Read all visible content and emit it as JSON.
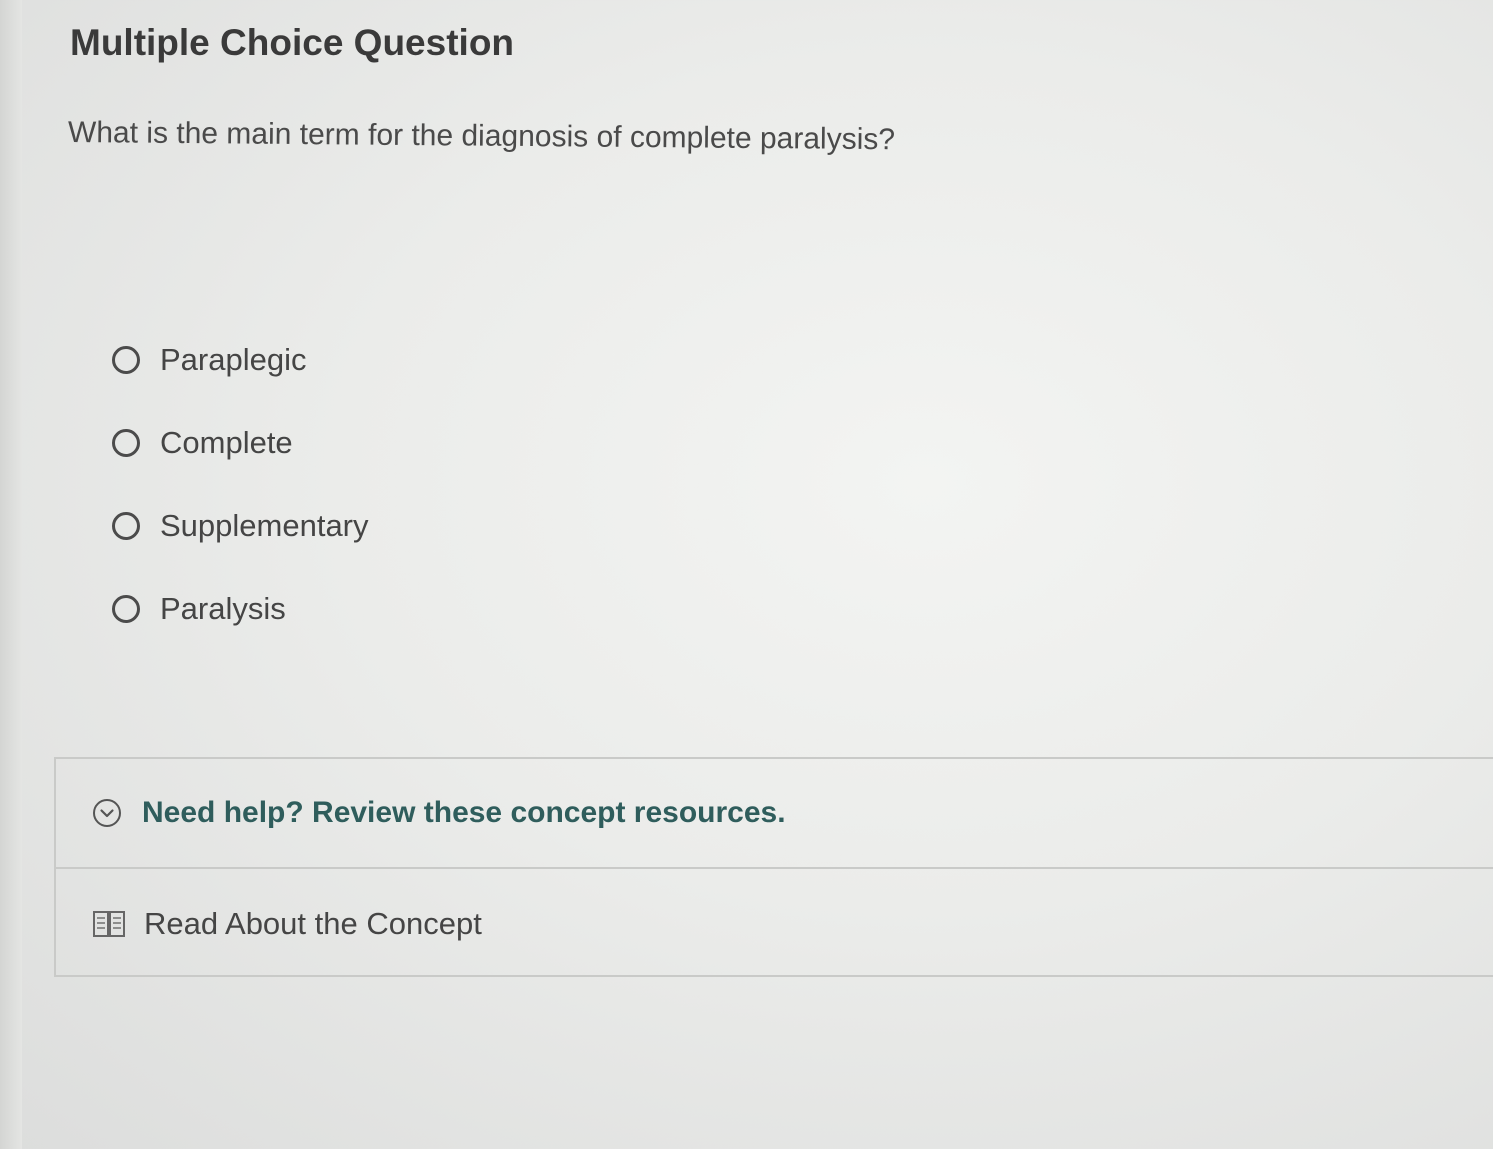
{
  "question_card": {
    "title": "Multiple Choice Question",
    "prompt": "What is the main term for the diagnosis of complete paralysis?",
    "choices": [
      {
        "label": "Paraplegic",
        "selected": false
      },
      {
        "label": "Complete",
        "selected": false
      },
      {
        "label": "Supplementary",
        "selected": false
      },
      {
        "label": "Paralysis",
        "selected": false
      }
    ]
  },
  "help": {
    "toggle_label": "Need help? Review these concept resources.",
    "toggle_icon": "chevron-down-circle-icon",
    "resources": [
      {
        "label": "Read About the Concept",
        "icon": "book-icon"
      }
    ]
  },
  "colors": {
    "accent": "#2f5d5c",
    "text": "#454545",
    "border": "#c9cac8"
  }
}
